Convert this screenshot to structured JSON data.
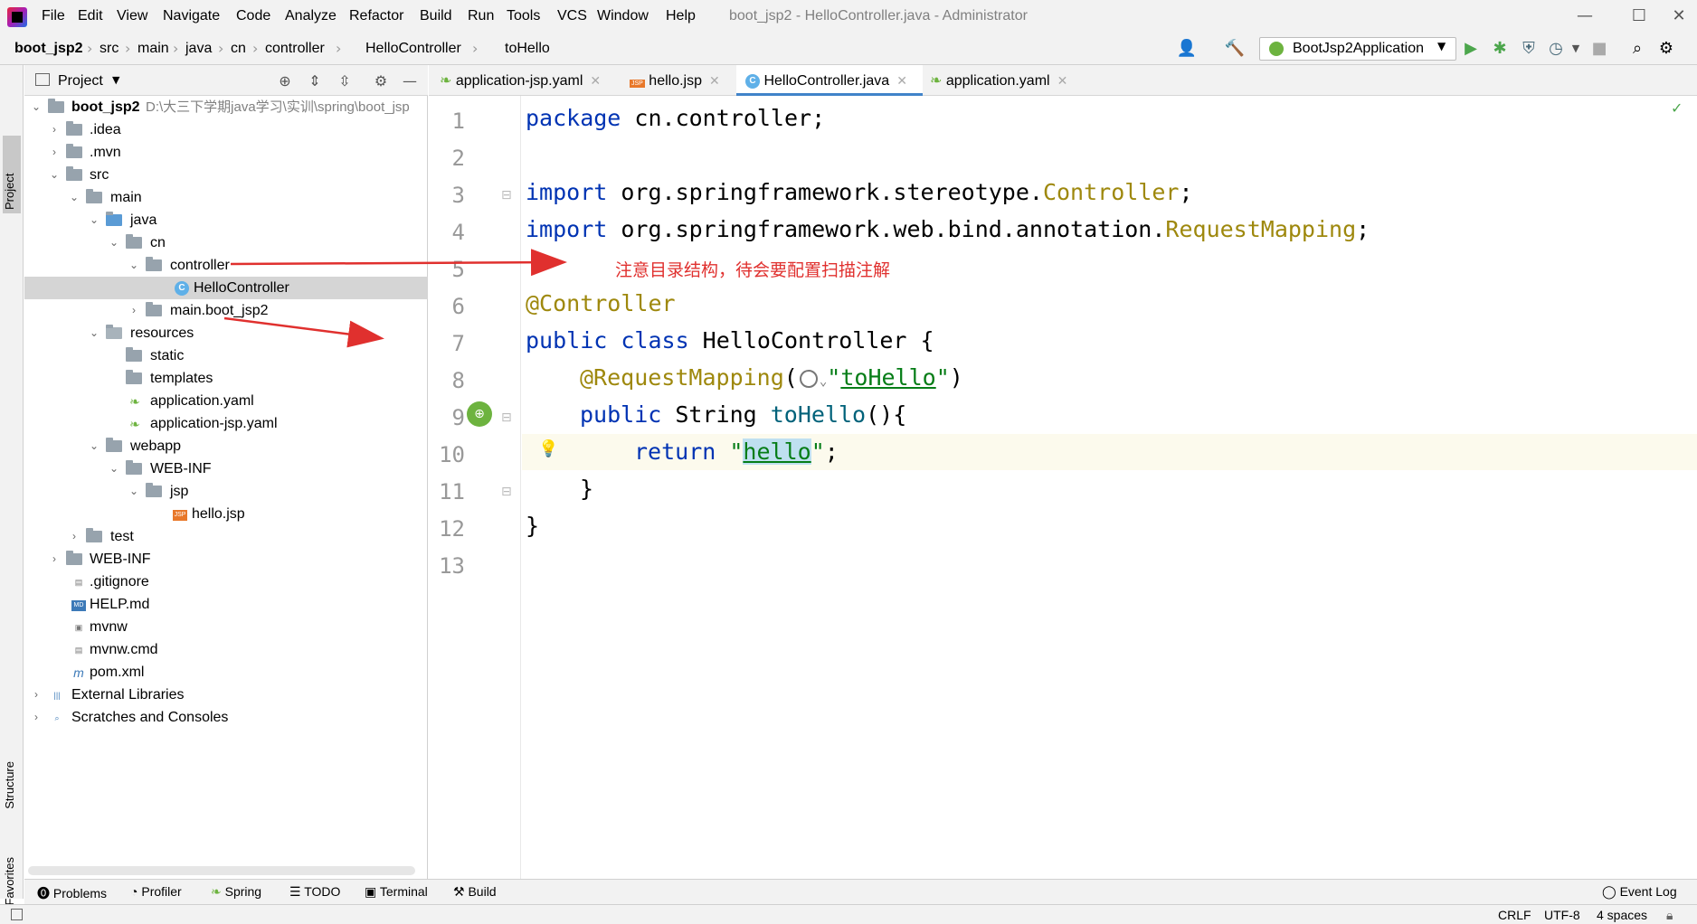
{
  "window": {
    "menu": [
      "File",
      "Edit",
      "View",
      "Navigate",
      "Code",
      "Analyze",
      "Refactor",
      "Build",
      "Run",
      "Tools",
      "VCS",
      "Window",
      "Help"
    ],
    "title": "boot_jsp2 - HelloController.java - Administrator"
  },
  "breadcrumb": [
    "boot_jsp2",
    "src",
    "main",
    "java",
    "cn",
    "controller",
    "HelloController",
    "toHello"
  ],
  "run_config": {
    "label": "BootJsp2Application"
  },
  "side_tabs": {
    "project": "Project",
    "structure": "Structure",
    "favorites": "Favorites"
  },
  "project_panel": {
    "title": "Project",
    "tree": [
      {
        "label": "boot_jsp2",
        "path": "D:\\大三下学期java学习\\实训\\spring\\boot_jsp"
      },
      {
        "label": ".idea"
      },
      {
        "label": ".mvn"
      },
      {
        "label": "src"
      },
      {
        "label": "main"
      },
      {
        "label": "java"
      },
      {
        "label": "cn"
      },
      {
        "label": "controller"
      },
      {
        "label": "HelloController"
      },
      {
        "label": "main.boot_jsp2"
      },
      {
        "label": "resources"
      },
      {
        "label": "static"
      },
      {
        "label": "templates"
      },
      {
        "label": "application.yaml"
      },
      {
        "label": "application-jsp.yaml"
      },
      {
        "label": "webapp"
      },
      {
        "label": "WEB-INF"
      },
      {
        "label": "jsp"
      },
      {
        "label": "hello.jsp"
      },
      {
        "label": "test"
      },
      {
        "label": "WEB-INF"
      },
      {
        "label": ".gitignore"
      },
      {
        "label": "HELP.md"
      },
      {
        "label": "mvnw"
      },
      {
        "label": "mvnw.cmd"
      },
      {
        "label": "pom.xml"
      },
      {
        "label": "External Libraries"
      },
      {
        "label": "Scratches and Consoles"
      }
    ]
  },
  "editor_tabs": [
    {
      "label": "application-jsp.yaml"
    },
    {
      "label": "hello.jsp"
    },
    {
      "label": "HelloController.java"
    },
    {
      "label": "application.yaml"
    }
  ],
  "code": {
    "line_numbers": [
      "1",
      "2",
      "3",
      "4",
      "5",
      "6",
      "7",
      "8",
      "9",
      "10",
      "11",
      "12",
      "13"
    ],
    "l1_kw": "package",
    "l1_rest": " cn.controller;",
    "l3_kw": "import",
    "l3_rest": " org.springframework.stereotype.",
    "l3_ref": "Controller",
    "l3_end": ";",
    "l4_kw": "import",
    "l4_rest": " org.springframework.web.bind.annotation.",
    "l4_ref": "RequestMapping",
    "l4_end": ";",
    "l6_an": "@Controller",
    "l7_kw": "public class",
    "l7_rest": " HelloController {",
    "l8_an": "@RequestMapping",
    "l8_open": "(",
    "l8_q1": "\"",
    "l8_str": "toHello",
    "l8_q2": "\"",
    "l8_close": ")",
    "l9_kw": "public",
    "l9_rest": " String ",
    "l9_fn": "toHello",
    "l9_end": "(){",
    "l10_kw": "return",
    "l10_q1": " \"",
    "l10_str": "hello",
    "l10_q2": "\"",
    "l10_end": ";",
    "l11": "}",
    "l12": "}"
  },
  "annotation": {
    "text": "注意目录结构，待会要配置扫描注解",
    "color": "#e0302e"
  },
  "tool_strip": [
    "Problems",
    "Profiler",
    "Spring",
    "TODO",
    "Terminal",
    "Build",
    "Event Log"
  ],
  "status": {
    "line_sep": "CRLF",
    "encoding": "UTF-8",
    "indent": "4 spaces"
  }
}
